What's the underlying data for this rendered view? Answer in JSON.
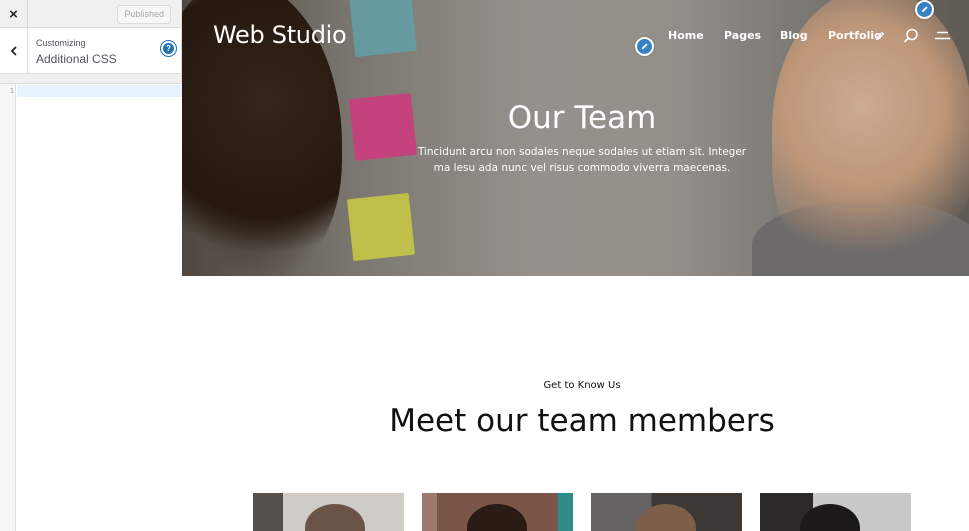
{
  "customizer": {
    "close_label": "×",
    "publish_label": "Published",
    "customizing_label": "Customizing",
    "section_title": "Additional CSS",
    "help_label": "?",
    "editor": {
      "line_numbers": [
        "1"
      ],
      "content": ""
    }
  },
  "site": {
    "brand": "Web Studio",
    "nav": [
      "Home",
      "Pages",
      "Blog",
      "Portfolio"
    ],
    "icons": [
      "pencil-icon",
      "search-icon",
      "menu-icon"
    ],
    "accent_color": "#3582c4"
  },
  "hero": {
    "title": "Our Team",
    "subtitle": "Tincidunt arcu non sodales neque sodales ut etiam sit. Integer ma lesu ada nunc vel risus commodo viverra maecenas."
  },
  "team_section": {
    "eyebrow": "Get to Know Us",
    "title": "Meet our team members",
    "members": [
      "member-photo-1",
      "member-photo-2",
      "member-photo-3",
      "member-photo-4"
    ]
  }
}
